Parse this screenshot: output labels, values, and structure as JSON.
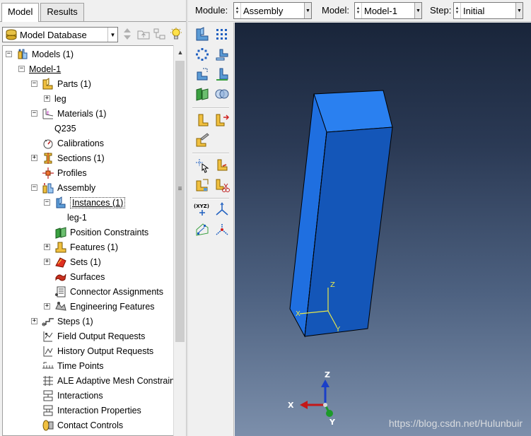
{
  "tabs": [
    {
      "label": "Model",
      "active": true
    },
    {
      "label": "Results",
      "active": false
    }
  ],
  "model_database": {
    "label": "Model Database"
  },
  "tree": [
    {
      "key": "models",
      "label": "Models (1)",
      "level": 0,
      "expander": "-"
    },
    {
      "key": "model-1",
      "label": "Model-1",
      "level": 1,
      "expander": "-"
    },
    {
      "key": "parts",
      "label": "Parts (1)",
      "level": 2,
      "expander": "-"
    },
    {
      "key": "leg",
      "label": "leg",
      "level": 3,
      "expander": "+"
    },
    {
      "key": "materials",
      "label": "Materials (1)",
      "level": 2,
      "expander": "-"
    },
    {
      "key": "q235",
      "label": "Q235",
      "level": 3,
      "expander": ""
    },
    {
      "key": "calibrations",
      "label": "Calibrations",
      "level": 2,
      "expander": ""
    },
    {
      "key": "sections",
      "label": "Sections (1)",
      "level": 2,
      "expander": "+"
    },
    {
      "key": "profiles",
      "label": "Profiles",
      "level": 2,
      "expander": ""
    },
    {
      "key": "assembly",
      "label": "Assembly",
      "level": 2,
      "expander": "-"
    },
    {
      "key": "instances",
      "label": "Instances (1)",
      "level": 3,
      "expander": "-"
    },
    {
      "key": "leg-1",
      "label": "leg-1",
      "level": 4,
      "expander": ""
    },
    {
      "key": "position-constraints",
      "label": "Position Constraints",
      "level": 3,
      "expander": ""
    },
    {
      "key": "features",
      "label": "Features (1)",
      "level": 3,
      "expander": "+"
    },
    {
      "key": "sets",
      "label": "Sets (1)",
      "level": 3,
      "expander": "+"
    },
    {
      "key": "surfaces",
      "label": "Surfaces",
      "level": 3,
      "expander": ""
    },
    {
      "key": "connector-assignments",
      "label": "Connector Assignments",
      "level": 3,
      "expander": ""
    },
    {
      "key": "engineering-features",
      "label": "Engineering Features",
      "level": 3,
      "expander": "+"
    },
    {
      "key": "steps",
      "label": "Steps (1)",
      "level": 2,
      "expander": "+"
    },
    {
      "key": "field-output-requests",
      "label": "Field Output Requests",
      "level": 2,
      "expander": ""
    },
    {
      "key": "history-output-requests",
      "label": "History Output Requests",
      "level": 2,
      "expander": ""
    },
    {
      "key": "time-points",
      "label": "Time Points",
      "level": 2,
      "expander": ""
    },
    {
      "key": "ale-adaptive-mesh",
      "label": "ALE Adaptive Mesh Constrain",
      "level": 2,
      "expander": ""
    },
    {
      "key": "interactions",
      "label": "Interactions",
      "level": 2,
      "expander": ""
    },
    {
      "key": "interaction-properties",
      "label": "Interaction Properties",
      "level": 2,
      "expander": ""
    },
    {
      "key": "contact-controls",
      "label": "Contact Controls",
      "level": 2,
      "expander": ""
    }
  ],
  "context_bar": {
    "module_label": "Module:",
    "module_value": "Assembly",
    "model_label": "Model:",
    "model_value": "Model-1",
    "step_label": "Step:",
    "step_value": "Initial"
  },
  "viewport": {
    "local_axes": {
      "x": "X",
      "y": "Y",
      "z": "Z"
    },
    "triad": {
      "x": "X",
      "y": "Y",
      "z": "Z"
    },
    "watermark": "https://blog.csdn.net/Hulunbuir"
  },
  "colors": {
    "part_face_light": "#1f6fe0",
    "part_face_dark": "#1150b0",
    "part_top": "#2a80f0",
    "axis_yellow": "#e8e84a"
  }
}
